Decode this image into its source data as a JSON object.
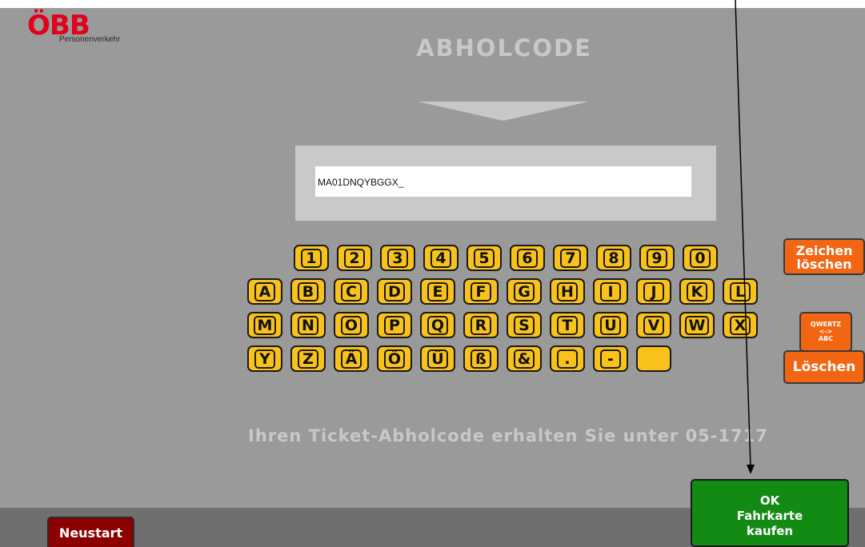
{
  "logo": {
    "mark": "ÖBB",
    "subtitle": "Personenverkehr"
  },
  "header": {
    "title": "ABHOLCODE"
  },
  "input": {
    "value": "MA01DNQYBGGX_"
  },
  "keyboard": {
    "rows": [
      [
        "1",
        "2",
        "3",
        "4",
        "5",
        "6",
        "7",
        "8",
        "9",
        "0"
      ],
      [
        "A",
        "B",
        "C",
        "D",
        "E",
        "F",
        "G",
        "H",
        "I",
        "J",
        "K",
        "L"
      ],
      [
        "M",
        "N",
        "O",
        "P",
        "Q",
        "R",
        "S",
        "T",
        "U",
        "V",
        "W",
        "X"
      ],
      [
        "Y",
        "Z",
        "Ä",
        "Ö",
        "Ü",
        "ß",
        "&",
        ".",
        "-",
        ""
      ]
    ]
  },
  "side_buttons": {
    "clear_char_line1": "Zeichen",
    "clear_char_line2": "löschen",
    "layout_line1": "QWERTZ",
    "layout_line2": "<->",
    "layout_line3": "ABC",
    "clear_all": "Löschen"
  },
  "hint": "Ihren Ticket-Abholcode erhalten Sie unter 05-1717",
  "footer": {
    "restart": "Neustart",
    "ok_line1": "OK",
    "ok_line2": "Fahrkarte",
    "ok_line3": "kaufen"
  },
  "colors": {
    "background": "#9a9a9a",
    "key_yellow": "#f9c21b",
    "action_orange": "#f26512",
    "ok_green": "#138a14",
    "restart_red": "#8b0000",
    "brand_red": "#e2001a"
  }
}
